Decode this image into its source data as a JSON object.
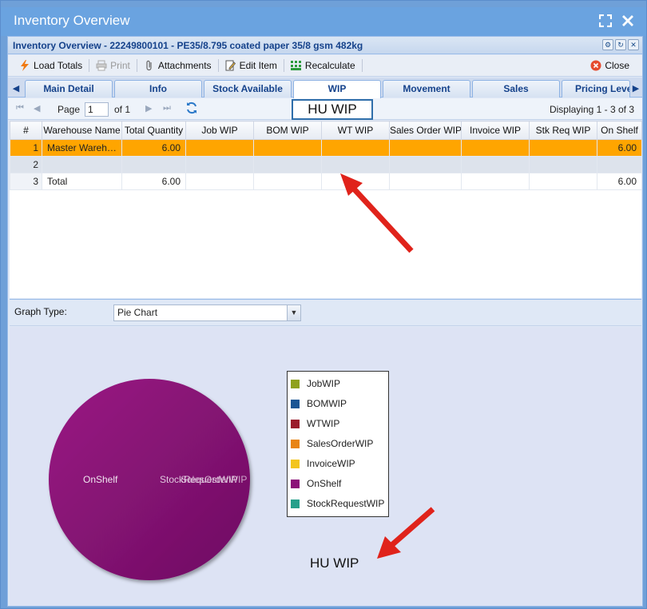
{
  "window": {
    "title": "Inventory Overview"
  },
  "subheader": {
    "title": "Inventory Overview - 22249800101 - PE35/8.795 coated paper 35/8 gsm 482kg"
  },
  "toolbar": {
    "load_totals": "Load Totals",
    "print": "Print",
    "attachments": "Attachments",
    "edit_item": "Edit Item",
    "recalculate": "Recalculate",
    "close": "Close"
  },
  "tabs": [
    {
      "label": "Main Detail"
    },
    {
      "label": "Info"
    },
    {
      "label": "Stock Available"
    },
    {
      "label": "WIP"
    },
    {
      "label": "Movement"
    },
    {
      "label": "Sales"
    },
    {
      "label": "Pricing Leve"
    }
  ],
  "pager": {
    "page_label": "Page",
    "page_value": "1",
    "of_label": "of 1",
    "displaying": "Displaying 1 - 3 of 3"
  },
  "annotation": {
    "hu_wip_top": "HU WIP",
    "hu_wip_bottom": "HU WIP",
    "arrow_color": "#e0231b"
  },
  "grid": {
    "columns": [
      "#",
      "Warehouse Name",
      "Total Quantity",
      "Job WIP",
      "BOM WIP",
      "WT WIP",
      "Sales Order WIP",
      "Invoice WIP",
      "Stk Req WIP",
      "On Shelf"
    ],
    "rows": [
      {
        "num": "1",
        "warehouse": "Master Wareho...",
        "total": "6.00",
        "job": "",
        "bom": "",
        "wt": "",
        "so": "",
        "inv": "",
        "stk": "",
        "shelf": "6.00"
      },
      {
        "num": "2",
        "warehouse": "",
        "total": "",
        "job": "",
        "bom": "",
        "wt": "",
        "so": "",
        "inv": "",
        "stk": "",
        "shelf": ""
      },
      {
        "num": "3",
        "warehouse": "Total",
        "total": "6.00",
        "job": "",
        "bom": "",
        "wt": "",
        "so": "",
        "inv": "",
        "stk": "",
        "shelf": "6.00"
      }
    ]
  },
  "graph": {
    "type_label": "Graph Type:",
    "type_value": "Pie Chart"
  },
  "chart_data": {
    "type": "pie",
    "slices": [
      {
        "name": "OnShelf",
        "value": 6.0,
        "color": "#8b1278"
      },
      {
        "name": "StockRequestWIP",
        "value": 0.0,
        "color": "#26a08b"
      }
    ],
    "slice_labels": [
      "OnShelf",
      "StockRequestWIP",
      "SalesOrderWIP"
    ],
    "legend": [
      {
        "name": "JobWIP",
        "color": "#8fa11c"
      },
      {
        "name": "BOMWIP",
        "color": "#1a5594"
      },
      {
        "name": "WTWIP",
        "color": "#9a1b2a"
      },
      {
        "name": "SalesOrderWIP",
        "color": "#e88415"
      },
      {
        "name": "InvoiceWIP",
        "color": "#f3c51e"
      },
      {
        "name": "OnShelf",
        "color": "#8b1278"
      },
      {
        "name": "StockRequestWIP",
        "color": "#26a08b"
      }
    ],
    "legend_position": "right"
  }
}
